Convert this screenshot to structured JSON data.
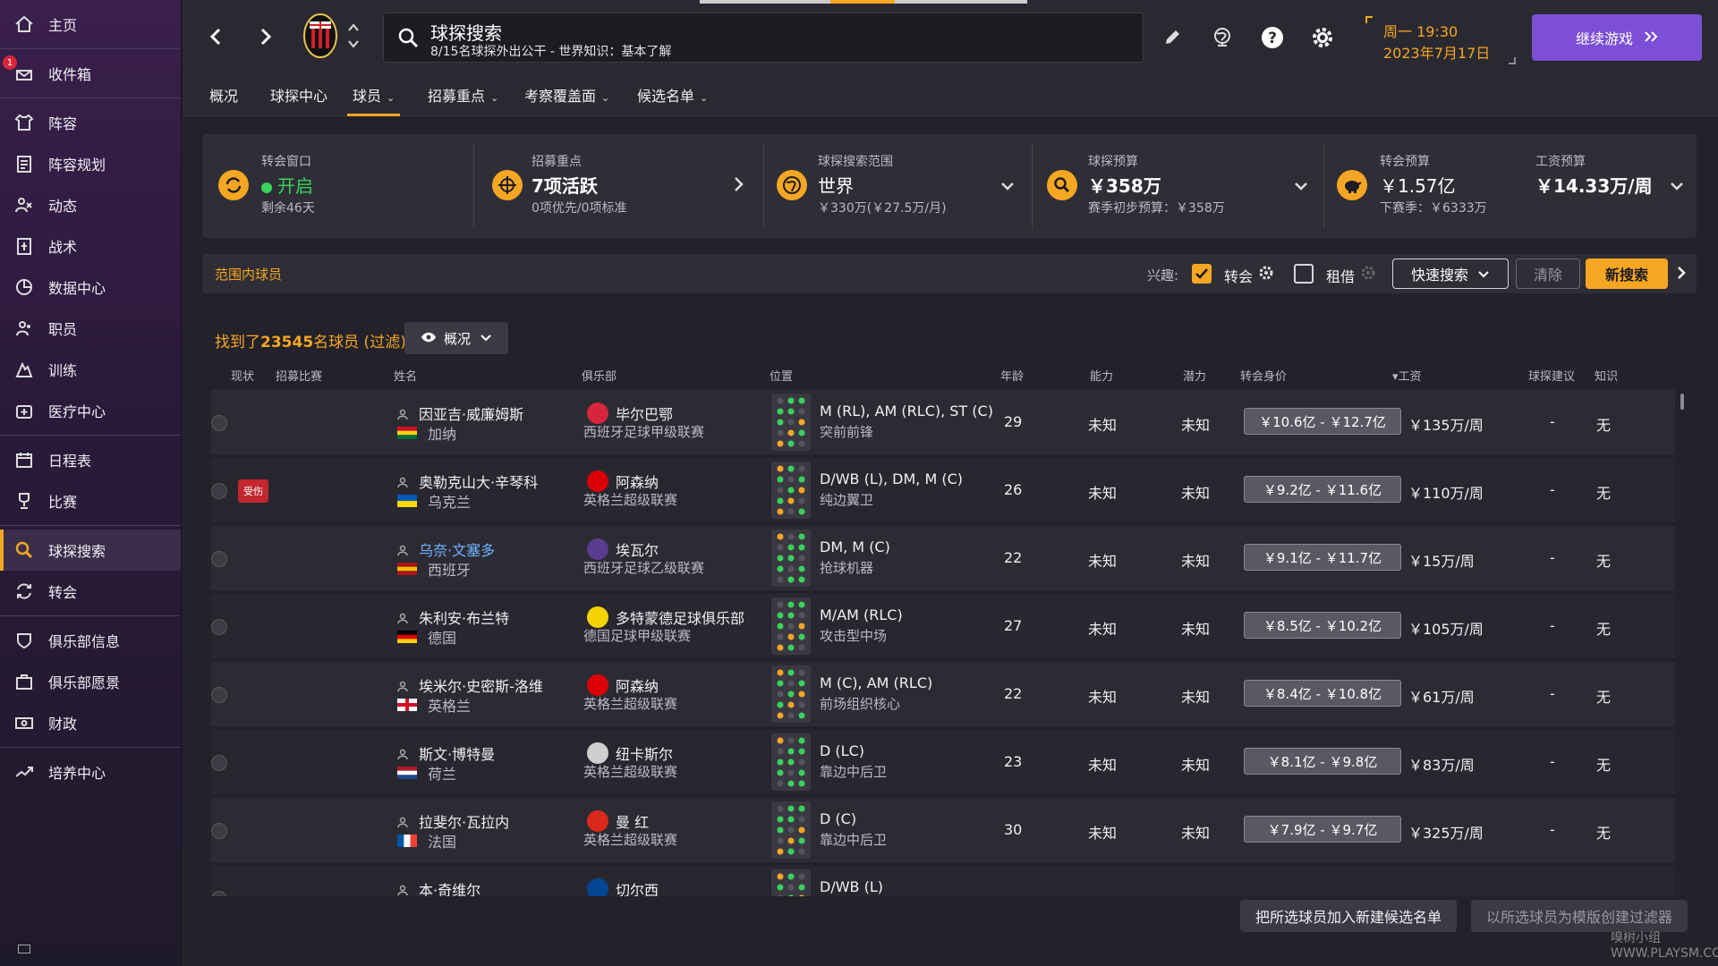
{
  "sidebar": {
    "items": [
      {
        "label": "主页",
        "icon": "home-icon"
      },
      {
        "label": "收件箱",
        "icon": "inbox-icon",
        "badge": "1"
      },
      {
        "label": "阵容",
        "icon": "squad-icon"
      },
      {
        "label": "阵容规划",
        "icon": "squad-planner-icon"
      },
      {
        "label": "动态",
        "icon": "dynamics-icon"
      },
      {
        "label": "战术",
        "icon": "tactics-icon"
      },
      {
        "label": "数据中心",
        "icon": "data-hub-icon"
      },
      {
        "label": "职员",
        "icon": "staff-icon"
      },
      {
        "label": "训练",
        "icon": "training-icon"
      },
      {
        "label": "医疗中心",
        "icon": "medical-icon"
      },
      {
        "label": "日程表",
        "icon": "calendar-icon"
      },
      {
        "label": "比赛",
        "icon": "trophy-icon"
      },
      {
        "label": "球探搜索",
        "icon": "scouting-icon",
        "active": true
      },
      {
        "label": "转会",
        "icon": "transfer-icon"
      },
      {
        "label": "俱乐部信息",
        "icon": "club-info-icon"
      },
      {
        "label": "俱乐部愿景",
        "icon": "club-vision-icon"
      },
      {
        "label": "财政",
        "icon": "finance-icon"
      },
      {
        "label": "培养中心",
        "icon": "development-icon"
      }
    ]
  },
  "topbar": {
    "search_title": "球探搜索",
    "search_sub": "8/15名球探外出公干 - 世界知识：基本了解",
    "date_line1": "周一 19:30",
    "date_line2": "2023年7月17日",
    "continue_label": "继续游戏"
  },
  "tabs": [
    {
      "label": "概况"
    },
    {
      "label": "球探中心"
    },
    {
      "label": "球员",
      "active": true,
      "dropdown": true
    },
    {
      "label": "招募重点",
      "dropdown": true
    },
    {
      "label": "考察覆盖面",
      "dropdown": true
    },
    {
      "label": "候选名单",
      "dropdown": true
    }
  ],
  "info": {
    "window": {
      "label": "转会窗口",
      "value": "开启",
      "sub": "剩余46天"
    },
    "focus": {
      "label": "招募重点",
      "value": "7项活跃",
      "sub": "0项优先/0项标准"
    },
    "range": {
      "label": "球探搜索范围",
      "value": "世界",
      "sub": "￥330万(￥27.5万/月)"
    },
    "budget": {
      "label": "球探预算",
      "value": "￥358万",
      "sub": "赛季初步预算：￥358万"
    },
    "transfer": {
      "label": "转会预算",
      "value": "￥1.57亿",
      "sub": "下赛季：￥6333万"
    },
    "wage": {
      "label": "工资预算",
      "value": "￥14.33万/周"
    }
  },
  "filter": {
    "range_title": "范围内球员",
    "interest_label": "兴趣:",
    "transfer_label": "转会",
    "loan_label": "租借",
    "quick_search": "快速搜索",
    "clear": "清除",
    "new_search": "新搜索"
  },
  "results": {
    "found_prefix": "找到了",
    "found_count": "23545",
    "found_suffix": "名球员 (过滤)",
    "view_label": "概况"
  },
  "columns": {
    "status": "现状",
    "recruit": "招募比赛",
    "name": "姓名",
    "club": "俱乐部",
    "position": "位置",
    "age": "年龄",
    "ability": "能力",
    "potential": "潜力",
    "value": "转会身价",
    "wage": "▾工资",
    "rec": "球探建议",
    "knowledge": "知识"
  },
  "players": [
    {
      "name": "因亚吉·威廉姆斯",
      "nation": "加纳",
      "club": "毕尔巴鄂",
      "league": "西班牙足球甲级联赛",
      "position": "M (RL), AM (RLC), ST (C)",
      "role": "突前前锋",
      "age": "29",
      "ability": "未知",
      "potential": "未知",
      "value": "￥10.6亿 - ￥12.7亿",
      "wage": "￥135万/周",
      "rec": "-",
      "knowledge": "无"
    },
    {
      "name": "奥勒克山大·辛琴科",
      "nation": "乌克兰",
      "club": "阿森纳",
      "league": "英格兰超级联赛",
      "position": "D/WB (L), DM, M (C)",
      "role": "纯边翼卫",
      "age": "26",
      "ability": "未知",
      "potential": "未知",
      "value": "￥9.2亿 - ￥11.6亿",
      "wage": "￥110万/周",
      "rec": "-",
      "knowledge": "无",
      "injury": "受伤"
    },
    {
      "name": "乌奈·文塞多",
      "nation": "西班牙",
      "club": "埃瓦尔",
      "league": "西班牙足球乙级联赛",
      "position": "DM, M (C)",
      "role": "抢球机器",
      "age": "22",
      "ability": "未知",
      "potential": "未知",
      "value": "￥9.1亿 - ￥11.7亿",
      "wage": "￥15万/周",
      "rec": "-",
      "knowledge": "无",
      "link": true
    },
    {
      "name": "朱利安·布兰特",
      "nation": "德国",
      "club": "多特蒙德足球俱乐部",
      "league": "德国足球甲级联赛",
      "position": "M/AM (RLC)",
      "role": "攻击型中场",
      "age": "27",
      "ability": "未知",
      "potential": "未知",
      "value": "￥8.5亿 - ￥10.2亿",
      "wage": "￥105万/周",
      "rec": "-",
      "knowledge": "无"
    },
    {
      "name": "埃米尔·史密斯-洛维",
      "nation": "英格兰",
      "club": "阿森纳",
      "league": "英格兰超级联赛",
      "position": "M (C), AM (RLC)",
      "role": "前场组织核心",
      "age": "22",
      "ability": "未知",
      "potential": "未知",
      "value": "￥8.4亿 - ￥10.8亿",
      "wage": "￥61万/周",
      "rec": "-",
      "knowledge": "无"
    },
    {
      "name": "斯文·博特曼",
      "nation": "荷兰",
      "club": "纽卡斯尔",
      "league": "英格兰超级联赛",
      "position": "D (LC)",
      "role": "靠边中后卫",
      "age": "23",
      "ability": "未知",
      "potential": "未知",
      "value": "￥8.1亿 - ￥9.8亿",
      "wage": "￥83万/周",
      "rec": "-",
      "knowledge": "无"
    },
    {
      "name": "拉斐尔·瓦拉内",
      "nation": "法国",
      "club": "曼 红",
      "league": "英格兰超级联赛",
      "position": "D (C)",
      "role": "靠边中后卫",
      "age": "30",
      "ability": "未知",
      "potential": "未知",
      "value": "￥7.9亿 - ￥9.7亿",
      "wage": "￥325万/周",
      "rec": "-",
      "knowledge": "无"
    },
    {
      "name": "本·奇维尔",
      "nation": "",
      "club": "切尔西",
      "league": "",
      "position": "D/WB (L)",
      "role": "",
      "age": "",
      "ability": "",
      "potential": "",
      "value": "",
      "wage": "",
      "rec": "",
      "knowledge": ""
    }
  ],
  "bottom": {
    "add_shortlist": "把所选球员加入新建候选名单",
    "create_filter": "以所选球员为模版创建过滤器"
  },
  "watermark": "嗅树小组 WWW.PLAYSM.CC",
  "colors": {
    "accent": "#f5a623",
    "purple": "#7c4fd6",
    "link": "#6fb3ff",
    "injury": "#c1272d"
  }
}
